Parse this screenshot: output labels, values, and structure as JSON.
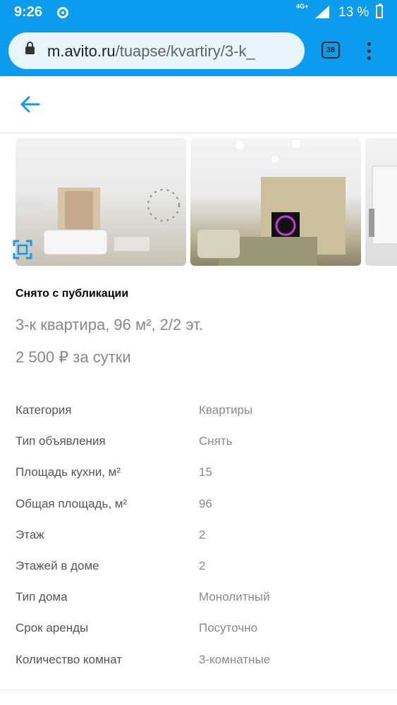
{
  "status_bar": {
    "time": "9:26",
    "network": "4G+",
    "battery": "13 %"
  },
  "browser": {
    "url_host": "m.avito.ru",
    "url_path": "/tuapse/kvartiry/3-k_",
    "tab_count": "38"
  },
  "listing": {
    "status": "Снято с публикации",
    "title": "3-к квартира, 96 м², 2/2 эт.",
    "price": "2 500 ₽ за сутки",
    "params": [
      {
        "key": "Категория",
        "value": "Квартиры"
      },
      {
        "key": "Тип объявления",
        "value": "Снять"
      },
      {
        "key": "Площадь кухни, м²",
        "value": "15"
      },
      {
        "key": "Общая площадь, м²",
        "value": "96"
      },
      {
        "key": "Этаж",
        "value": "2"
      },
      {
        "key": "Этажей в доме",
        "value": "2"
      },
      {
        "key": "Тип дома",
        "value": "Монолитный"
      },
      {
        "key": "Срок аренды",
        "value": "Посуточно"
      },
      {
        "key": "Количество комнат",
        "value": "3-комнатные"
      }
    ]
  },
  "colors": {
    "browser_bar": "#0b9cf0",
    "accent": "#0b9cf0"
  },
  "icons": [
    "chrome-icon",
    "signal-icon",
    "battery-icon",
    "lock-icon",
    "tabs-icon",
    "more-menu-icon",
    "back-arrow-icon",
    "fullscreen-icon"
  ]
}
